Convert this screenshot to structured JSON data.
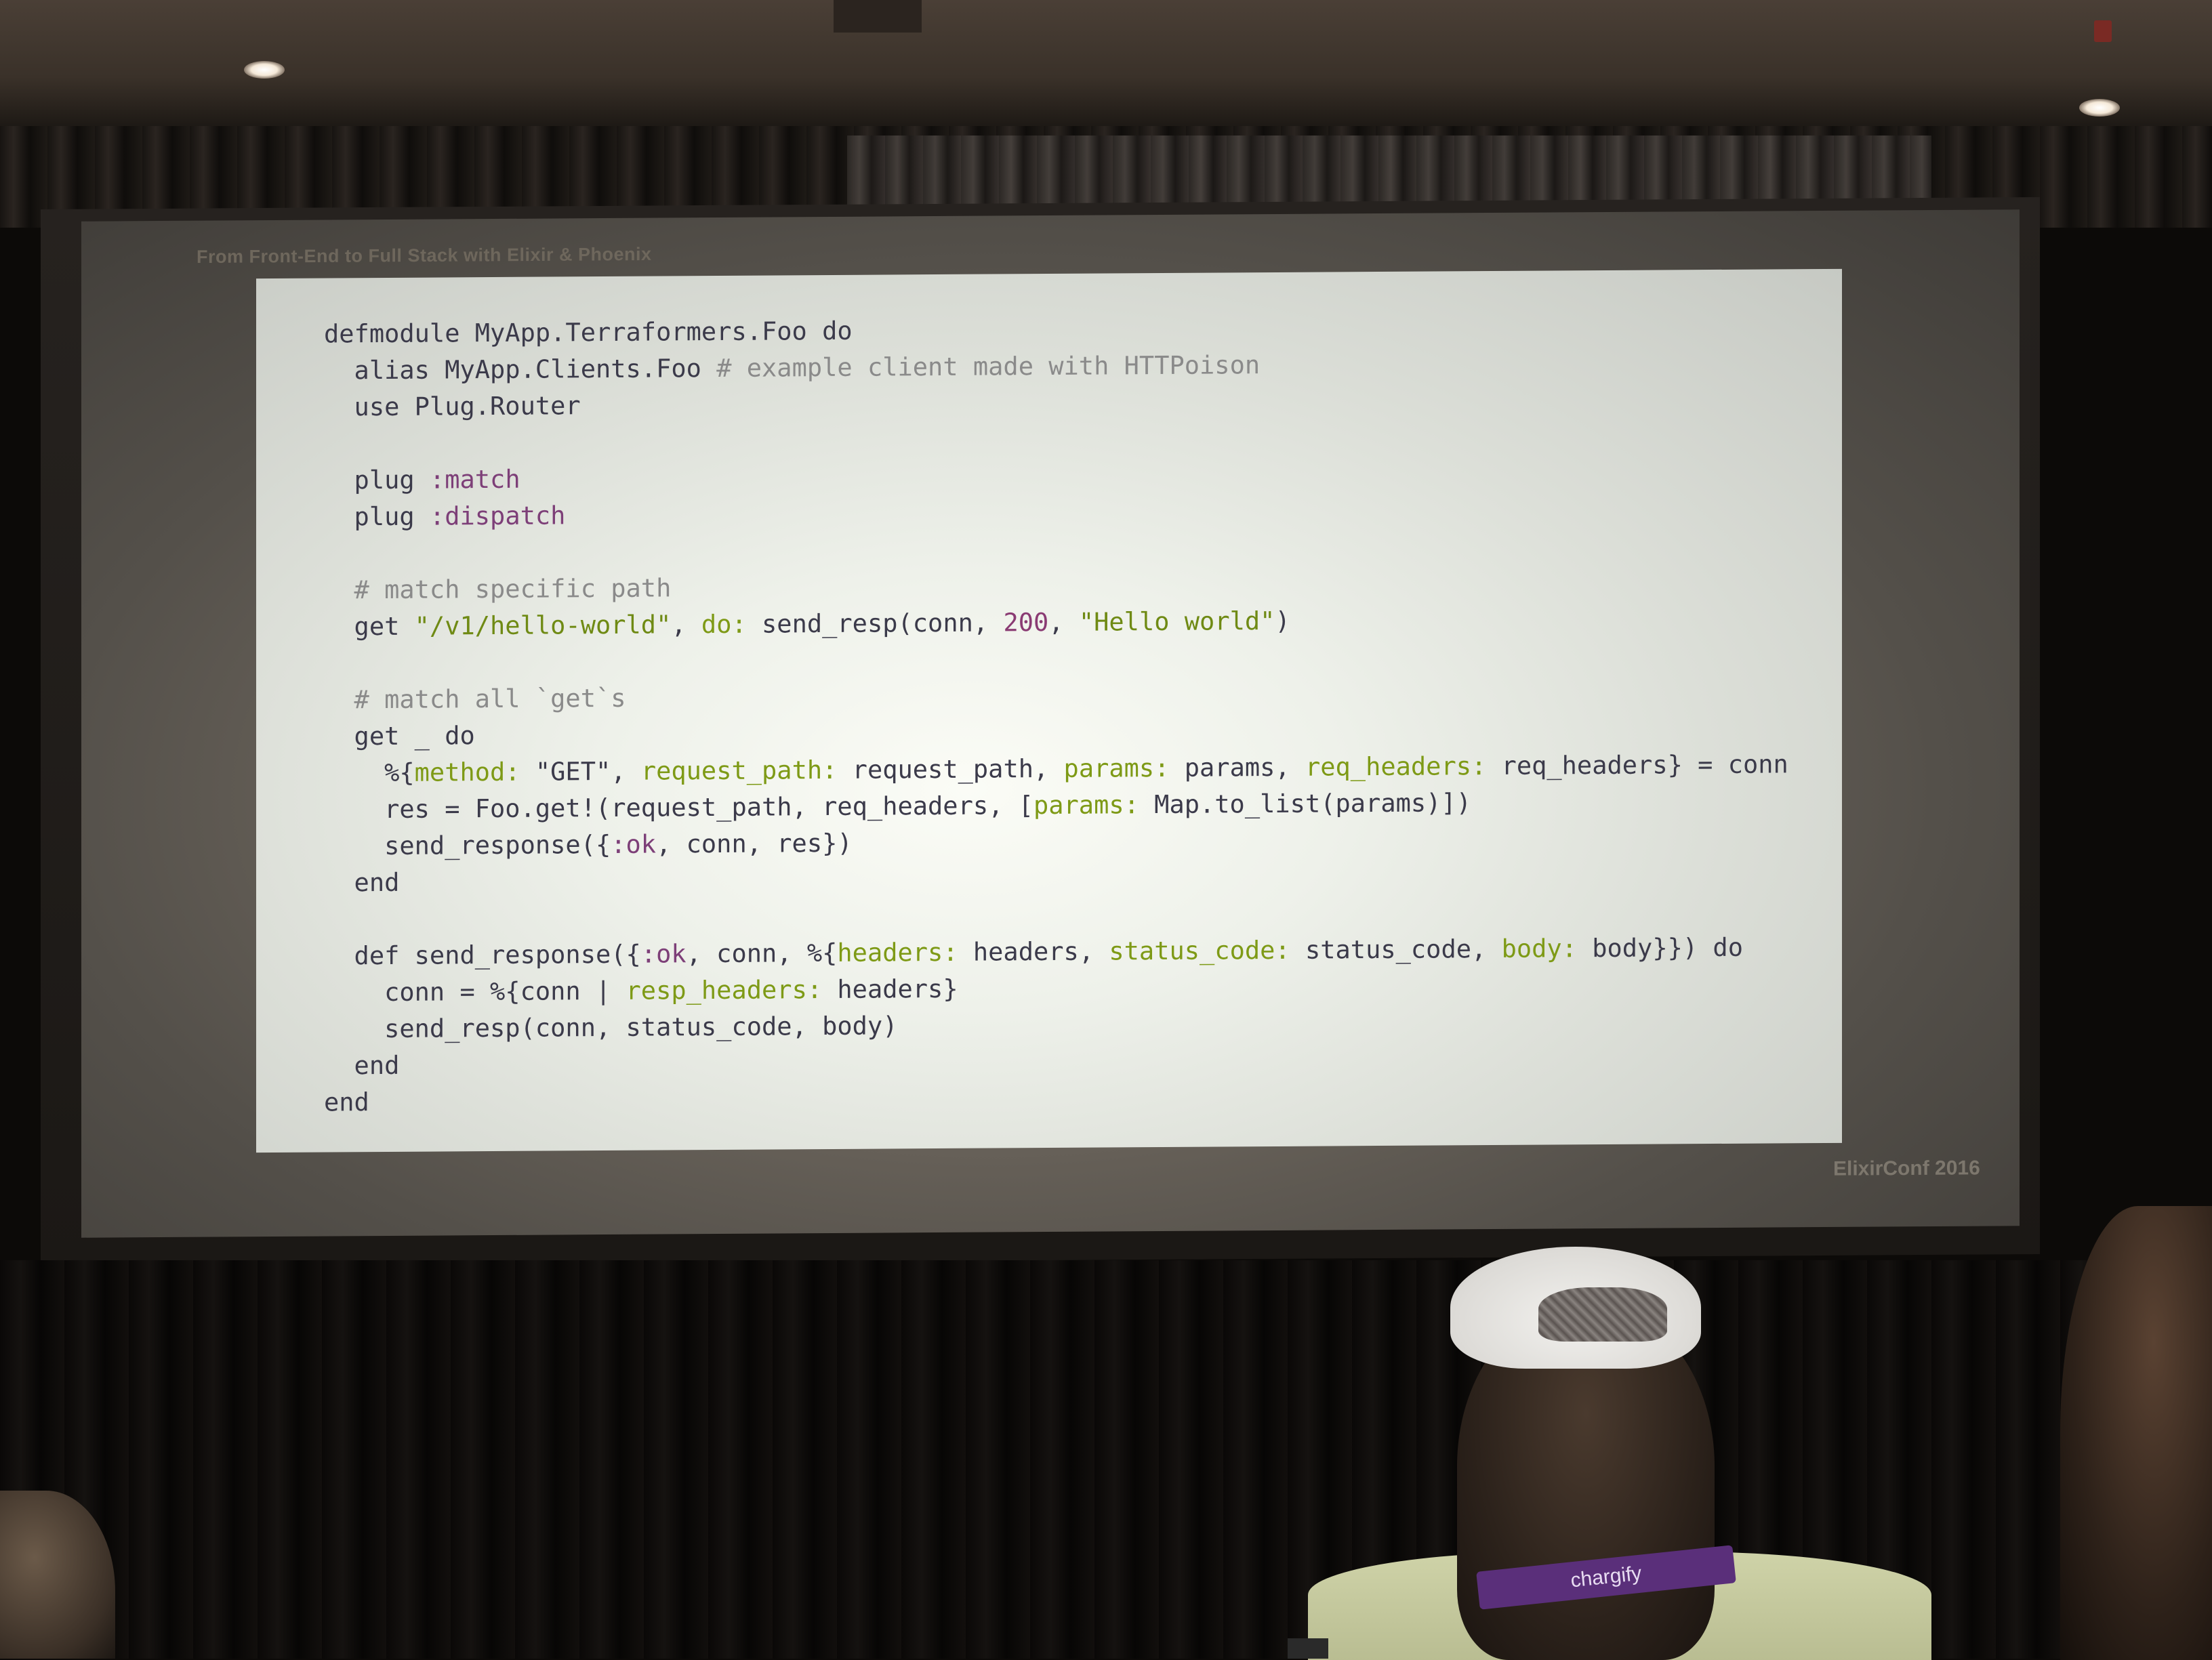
{
  "slide": {
    "talk_title": "From Front-End to Full Stack with Elixir & Phoenix",
    "conference": "ElixirConf 2016"
  },
  "code_lines": [
    [
      {
        "t": "defmodule MyApp.Terraformers.Foo do",
        "c": "kw"
      }
    ],
    [
      {
        "t": "  alias MyApp.Clients.Foo ",
        "c": "kw"
      },
      {
        "t": "# example client made with HTTPoison",
        "c": "cm"
      }
    ],
    [
      {
        "t": "  use Plug.Router",
        "c": "kw"
      }
    ],
    [],
    [
      {
        "t": "  plug ",
        "c": "kw"
      },
      {
        "t": ":match",
        "c": "sym"
      }
    ],
    [
      {
        "t": "  plug ",
        "c": "kw"
      },
      {
        "t": ":dispatch",
        "c": "sym"
      }
    ],
    [],
    [
      {
        "t": "  # match specific path",
        "c": "cm"
      }
    ],
    [
      {
        "t": "  get ",
        "c": "kw"
      },
      {
        "t": "\"/v1/hello-world\"",
        "c": "str"
      },
      {
        "t": ", ",
        "c": "kw"
      },
      {
        "t": "do:",
        "c": "key"
      },
      {
        "t": " send_resp(conn, ",
        "c": "kw"
      },
      {
        "t": "200",
        "c": "num"
      },
      {
        "t": ", ",
        "c": "kw"
      },
      {
        "t": "\"Hello world\"",
        "c": "str"
      },
      {
        "t": ")",
        "c": "kw"
      }
    ],
    [],
    [
      {
        "t": "  # match all `get`s",
        "c": "cm"
      }
    ],
    [
      {
        "t": "  get _ do",
        "c": "kw"
      }
    ],
    [
      {
        "t": "    %{",
        "c": "kw"
      },
      {
        "t": "method:",
        "c": "key"
      },
      {
        "t": " \"GET\", ",
        "c": "kw"
      },
      {
        "t": "request_path:",
        "c": "key"
      },
      {
        "t": " request_path, ",
        "c": "kw"
      },
      {
        "t": "params:",
        "c": "key"
      },
      {
        "t": " params, ",
        "c": "kw"
      },
      {
        "t": "req_headers:",
        "c": "key"
      },
      {
        "t": " req_headers} = conn",
        "c": "kw"
      }
    ],
    [
      {
        "t": "    res = Foo.get!(request_path, req_headers, [",
        "c": "kw"
      },
      {
        "t": "params:",
        "c": "key"
      },
      {
        "t": " Map.to_list(params)])",
        "c": "kw"
      }
    ],
    [
      {
        "t": "    send_response({",
        "c": "kw"
      },
      {
        "t": ":ok",
        "c": "sym"
      },
      {
        "t": ", conn, res})",
        "c": "kw"
      }
    ],
    [
      {
        "t": "  end",
        "c": "kw"
      }
    ],
    [],
    [
      {
        "t": "  def send_response({",
        "c": "kw"
      },
      {
        "t": ":ok",
        "c": "sym"
      },
      {
        "t": ", conn, %{",
        "c": "kw"
      },
      {
        "t": "headers:",
        "c": "key"
      },
      {
        "t": " headers, ",
        "c": "kw"
      },
      {
        "t": "status_code:",
        "c": "key"
      },
      {
        "t": " status_code, ",
        "c": "kw"
      },
      {
        "t": "body:",
        "c": "key"
      },
      {
        "t": " body}}) do",
        "c": "kw"
      }
    ],
    [
      {
        "t": "    conn = %{conn | ",
        "c": "kw"
      },
      {
        "t": "resp_headers:",
        "c": "key"
      },
      {
        "t": " headers}",
        "c": "kw"
      }
    ],
    [
      {
        "t": "    send_resp(conn, status_code, body)",
        "c": "kw"
      }
    ],
    [
      {
        "t": "  end",
        "c": "kw"
      }
    ],
    [
      {
        "t": "end",
        "c": "kw"
      }
    ]
  ],
  "audience": {
    "lanyard_text": "chargify"
  }
}
